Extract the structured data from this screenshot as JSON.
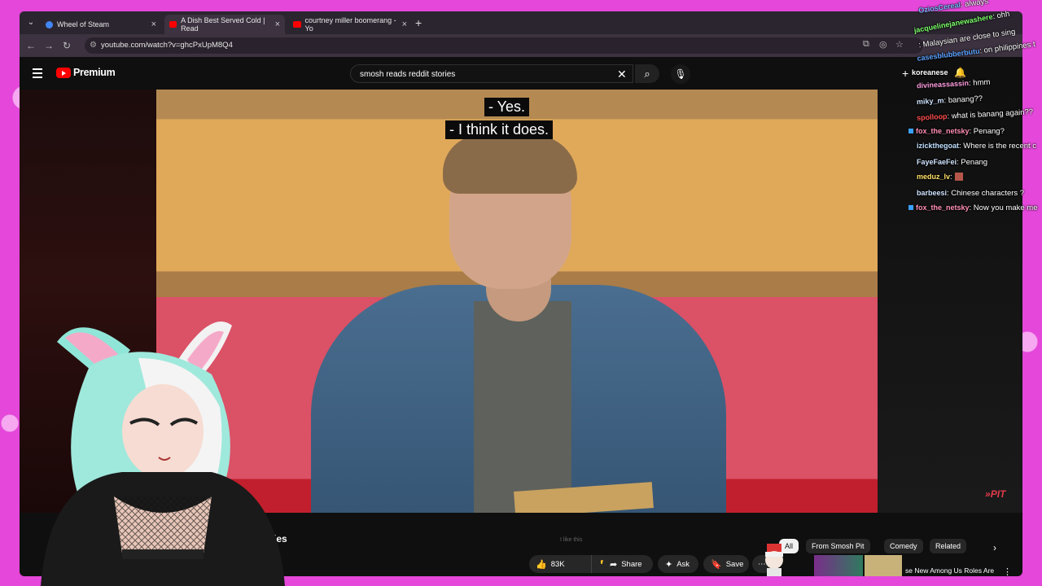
{
  "browser": {
    "tabs": [
      {
        "label": "Wheel of Steam",
        "fav_color": "#4285f4"
      },
      {
        "label": "A Dish Best Served Cold | Read",
        "fav_color": "#ff0000"
      },
      {
        "label": "courtney miller boomerang - Yo",
        "fav_color": "#ff0000"
      }
    ],
    "url": "youtube.com/watch?v=ghcPxUpM8Q4"
  },
  "youtube": {
    "brand": "Premium",
    "search_query": "smosh reads reddit stories"
  },
  "video": {
    "caption_line1": "- Yes.",
    "caption_line2": "- I think it does.",
    "watermark": "PIT",
    "title_fragment": "dit Stories"
  },
  "chat": [
    {
      "user": "OziosCereal",
      "text": ": always"
    },
    {
      "user": "jacquelinejanewashere",
      "text": ": ohh"
    },
    {
      "user": "",
      "text": ": Malaysian are close to sing"
    },
    {
      "user": "casesblubberbutu",
      "text": ": on philippines t"
    },
    {
      "user": "koreanese",
      "text": ""
    },
    {
      "user": "divineassassin",
      "text": ": hmm"
    },
    {
      "user": "miky_m",
      "text": ": banang??"
    },
    {
      "user": "spolloop",
      "text": ": what is banang again??"
    },
    {
      "user": "fox_the_netsky",
      "text": ": Penang?"
    },
    {
      "user": "izickthegoat",
      "text": ": Where is the recent c"
    },
    {
      "user": "FayeFaeFei",
      "text": ": Penang"
    },
    {
      "user": "meduz_lv",
      "text": ":"
    },
    {
      "user": "barbeesi",
      "text": ": Chinese characters ?"
    },
    {
      "user": "fox_the_netsky",
      "text": ": Now you make me"
    }
  ],
  "actions": {
    "tooltip": "I like this",
    "like_count": "83K",
    "share": "Share",
    "ask": "Ask",
    "save": "Save"
  },
  "chips": [
    "All",
    "From Smosh Pit",
    "Comedy",
    "Related"
  ],
  "recommendation": {
    "title": "se New Among Us Roles Are ZY"
  },
  "colors": {
    "frame": "#e447da",
    "yt_red": "#ff0000",
    "window_bg": "#0f0f0f"
  }
}
